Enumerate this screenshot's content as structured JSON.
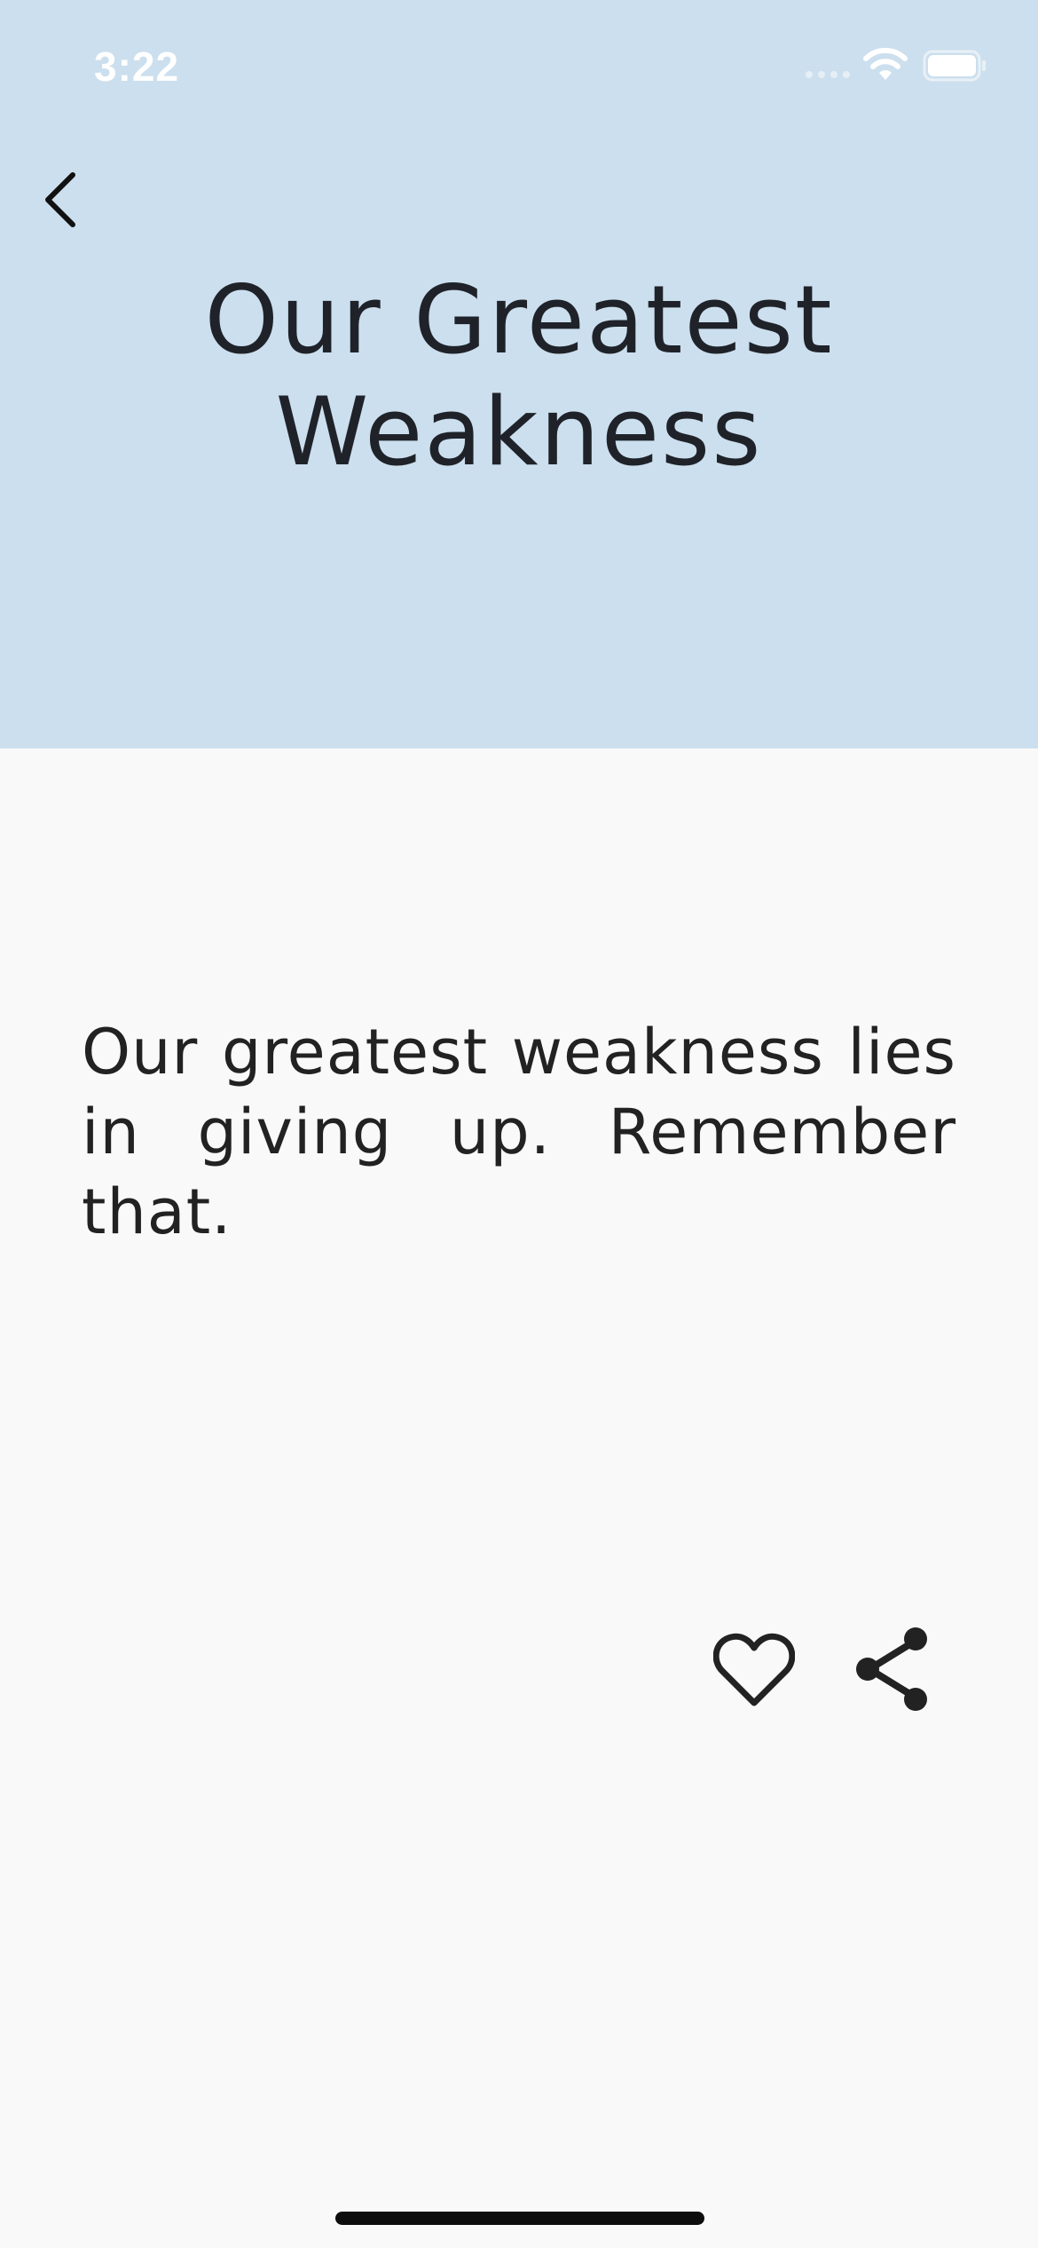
{
  "status_bar": {
    "time": "3:22"
  },
  "header": {
    "title": "Our Greatest Weakness",
    "background_color": "#ccdfee",
    "back_icon": "chevron-left-icon"
  },
  "quote": {
    "text": "Our greatest weakness lies in giving up. Remember that."
  },
  "actions": {
    "like_icon": "heart-outline-icon",
    "share_icon": "share-icon"
  }
}
